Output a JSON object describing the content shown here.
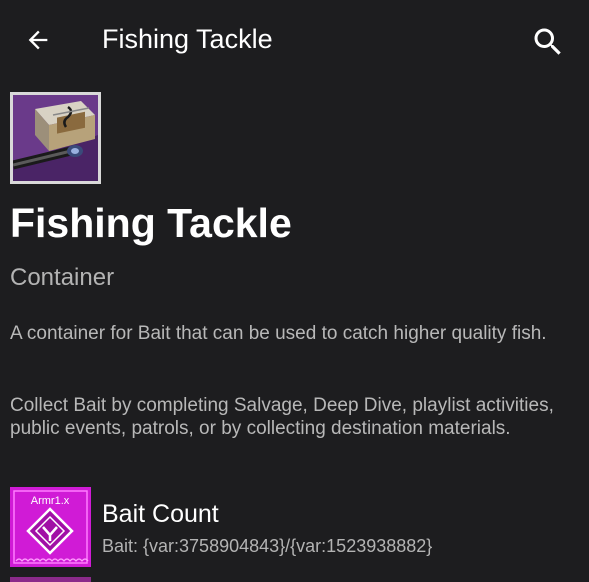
{
  "appbar": {
    "title": "Fishing Tackle",
    "back_icon": "arrow-back-icon",
    "search_icon": "search-icon"
  },
  "item": {
    "name": "Fishing Tackle",
    "type": "Container",
    "description": [
      "A container for Bait that can be used to catch higher quality fish.",
      "Collect Bait by completing Salvage, Deep Dive, playlist activities, public events, patrols, or by collecting destination materials."
    ]
  },
  "objective": {
    "icon_label": "Armr1.x",
    "title": "Bait Count",
    "progress_text": "Bait: {var:3758904843}/{var:1523938882}"
  },
  "colors": {
    "background": "#1d1d1f",
    "item_icon_bg": "#5b2f7e",
    "objective_icon_bg": "#d01bd6"
  }
}
